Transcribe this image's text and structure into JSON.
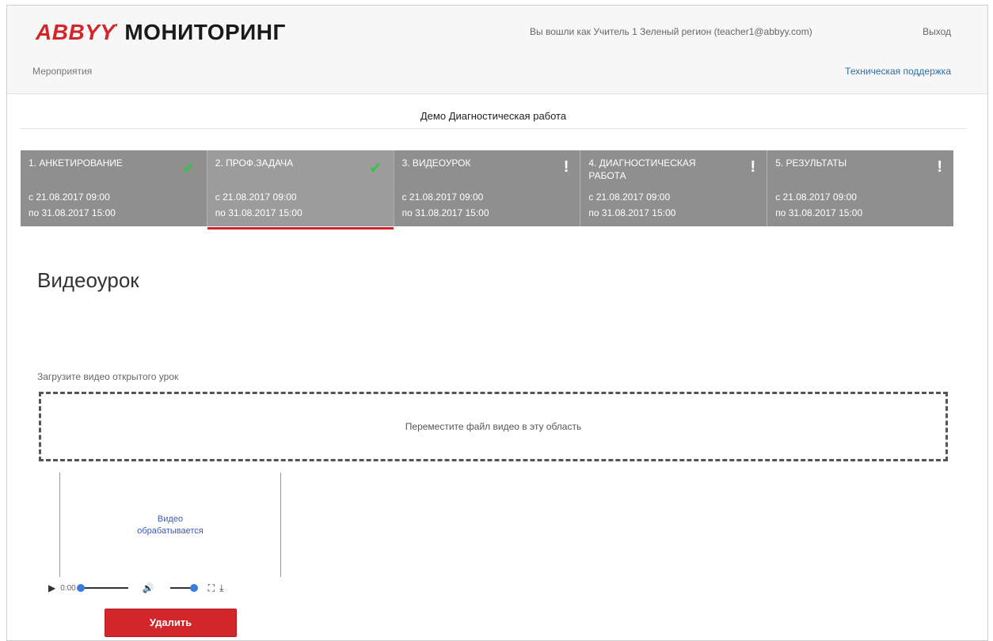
{
  "header": {
    "logo_brand": "ABBYY",
    "logo_product": "МОНИТОРИНГ",
    "user_info": "Вы вошли как Учитель 1 Зеленый регион (teacher1@abbyy.com)",
    "logout": "Выход",
    "nav_events": "Мероприятия",
    "support": "Техническая поддержка"
  },
  "event_title": "Демо Диагностическая работа",
  "steps": [
    {
      "title": "1. Анкетирование",
      "from": "с 21.08.2017 09:00",
      "to": "по 31.08.2017 15:00",
      "status": "done",
      "icon": "check-icon"
    },
    {
      "title": "2. Проф.задача",
      "from": "с 21.08.2017 09:00",
      "to": "по 31.08.2017 15:00",
      "status": "done",
      "icon": "check-icon",
      "active": true
    },
    {
      "title": "3. Видеоурок",
      "from": "с 21.08.2017 09:00",
      "to": "по 31.08.2017 15:00",
      "status": "pending",
      "icon": "exclamation-icon"
    },
    {
      "title": "4. Диагностическая работа",
      "from": "с 21.08.2017 09:00",
      "to": "по 31.08.2017 15:00",
      "status": "pending",
      "icon": "exclamation-icon"
    },
    {
      "title": "5. Результаты",
      "from": "с 21.08.2017 09:00",
      "to": "по 31.08.2017 15:00",
      "status": "pending",
      "icon": "exclamation-icon"
    }
  ],
  "page_title": "Видеоурок",
  "upload": {
    "label": "Загрузите видео открытого урок",
    "dropzone_text": "Переместите файл видео в эту область"
  },
  "video": {
    "status_line1": "Видео",
    "status_line2": "обрабатывается",
    "time": "0:00",
    "progress": 0,
    "volume": 1
  },
  "delete_label": "Удалить",
  "colors": {
    "accent": "#d3262b",
    "check": "#38c24a",
    "steps_bg": "#8f8f8f"
  }
}
